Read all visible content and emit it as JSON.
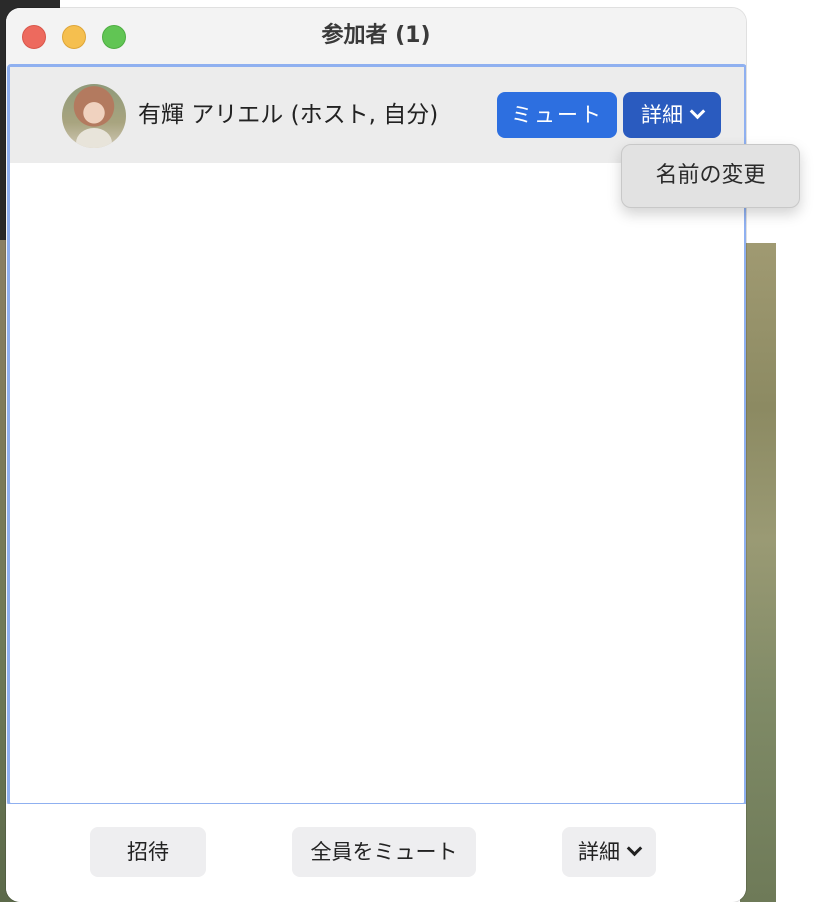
{
  "window": {
    "title": "参加者 (1)"
  },
  "participant": {
    "name": "有輝 アリエル (ホスト, 自分)",
    "mute_label": "ミュート",
    "more_label": "詳細"
  },
  "more_menu": {
    "items": [
      "名前の変更"
    ]
  },
  "footer": {
    "invite_label": "招待",
    "mute_all_label": "全員をミュート",
    "more_label": "詳細"
  },
  "colors": {
    "mute_button": "#2d6fe0",
    "more_button": "#2a5bbf",
    "list_border": "#8fb0f0"
  }
}
